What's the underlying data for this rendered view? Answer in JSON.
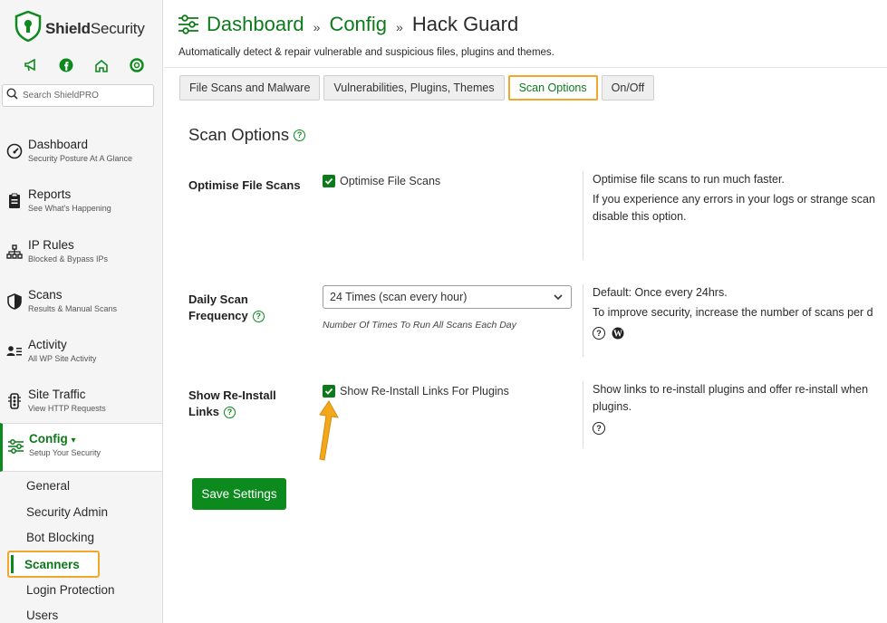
{
  "brand": {
    "name_bold": "Shield",
    "name_rest": "Security"
  },
  "sidebar": {
    "quick_icons": [
      "megaphone-icon",
      "facebook-icon",
      "home-icon",
      "lifebuoy-icon"
    ],
    "search": {
      "placeholder": "Search ShieldPRO"
    },
    "items": [
      {
        "title": "Dashboard",
        "sub": "Security Posture At A Glance",
        "icon": "gauge-icon"
      },
      {
        "title": "Reports",
        "sub": "See What's Happening",
        "icon": "clipboard-icon"
      },
      {
        "title": "IP Rules",
        "sub": "Blocked & Bypass IPs",
        "icon": "network-icon"
      },
      {
        "title": "Scans",
        "sub": "Results & Manual Scans",
        "icon": "shield-half-icon"
      },
      {
        "title": "Activity",
        "sub": "All WP Site Activity",
        "icon": "user-list-icon"
      },
      {
        "title": "Site Traffic",
        "sub": "View HTTP Requests",
        "icon": "traffic-icon"
      },
      {
        "title": "Config",
        "sub": "Setup Your Security",
        "icon": "sliders-icon",
        "caret": "▾"
      }
    ],
    "sub_items": [
      "General",
      "Security Admin",
      "Bot Blocking",
      "Scanners",
      "Login Protection",
      "Users"
    ]
  },
  "header": {
    "crumbs": [
      "Dashboard",
      "Config",
      "Hack Guard"
    ],
    "separator": "»",
    "subtitle": "Automatically detect & repair vulnerable and suspicious files, plugins and themes."
  },
  "tabs": [
    "File Scans and Malware",
    "Vulnerabilities, Plugins, Themes",
    "Scan Options",
    "On/Off"
  ],
  "panel": {
    "title": "Scan Options",
    "options": [
      {
        "label_lines": [
          "Optimise File Scans"
        ],
        "control_label": "Optimise File Scans",
        "desc": [
          "Optimise file scans to run much faster.",
          "If you experience any errors in your logs or strange scan",
          "disable this option."
        ]
      },
      {
        "label_lines": [
          "Daily Scan",
          "Frequency"
        ],
        "select_value": "24 Times (scan every hour)",
        "hint": "Number Of Times To Run All Scans Each Day",
        "desc": [
          "Default: Once every 24hrs.",
          "To improve security, increase the number of scans per d"
        ]
      },
      {
        "label_lines": [
          "Show Re-Install",
          "Links"
        ],
        "control_label": "Show Re-Install Links For Plugins",
        "desc": [
          "Show links to re-install plugins and offer re-install when",
          "plugins."
        ]
      }
    ],
    "save_label": "Save Settings"
  },
  "colors": {
    "brand_green": "#0c8a1e",
    "highlight_orange": "#f0a72b"
  }
}
